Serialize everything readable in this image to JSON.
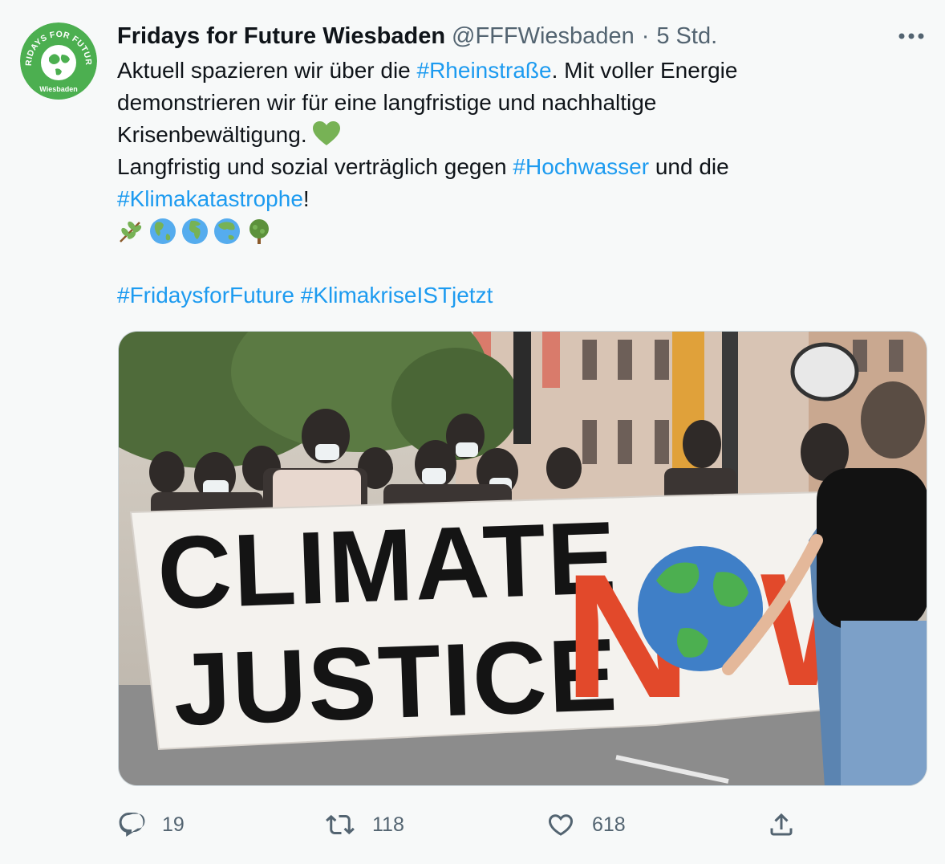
{
  "author": {
    "display_name": "Fridays for Future Wiesbaden",
    "handle": "@FFFWiesbaden",
    "separator": "·",
    "time": "5 Std.",
    "avatar": {
      "ring_text": "FRIDAYS FOR FUTURE",
      "bottom_text": "Wiesbaden",
      "color": "#4caf50"
    }
  },
  "tweet": {
    "line1_a": "Aktuell spazieren wir über die ",
    "line1_tag": "#Rheinstraße",
    "line1_b": ". Mit voller Energie",
    "line2": "demonstrieren wir für eine langfristige und nachhaltige",
    "line3": "Krisenbewältigung.",
    "line3_emoji": "green-heart",
    "line4_a": "Langfristig und sozial verträglich gegen ",
    "line4_tag": "#Hochwasser",
    "line4_b": " und die",
    "line5_tag": "#Klimakatastrophe",
    "line5_b": "!",
    "emojis": [
      "herb",
      "globe-americas",
      "globe-europe-africa",
      "globe-asia-australia",
      "deciduous-tree"
    ],
    "hashtag_1": "#FridaysforFuture",
    "hashtag_2": "#KlimakriseISTjetzt"
  },
  "media": {
    "banner_line1": "CLIMATE",
    "banner_line2": "JUSTICE",
    "banner_word_n": "N",
    "banner_word_w": "W"
  },
  "actions": {
    "reply_count": "19",
    "retweet_count": "118",
    "like_count": "618"
  },
  "colors": {
    "link": "#1d9bf0",
    "muted": "#536471",
    "accent_green": "#4caf50"
  }
}
